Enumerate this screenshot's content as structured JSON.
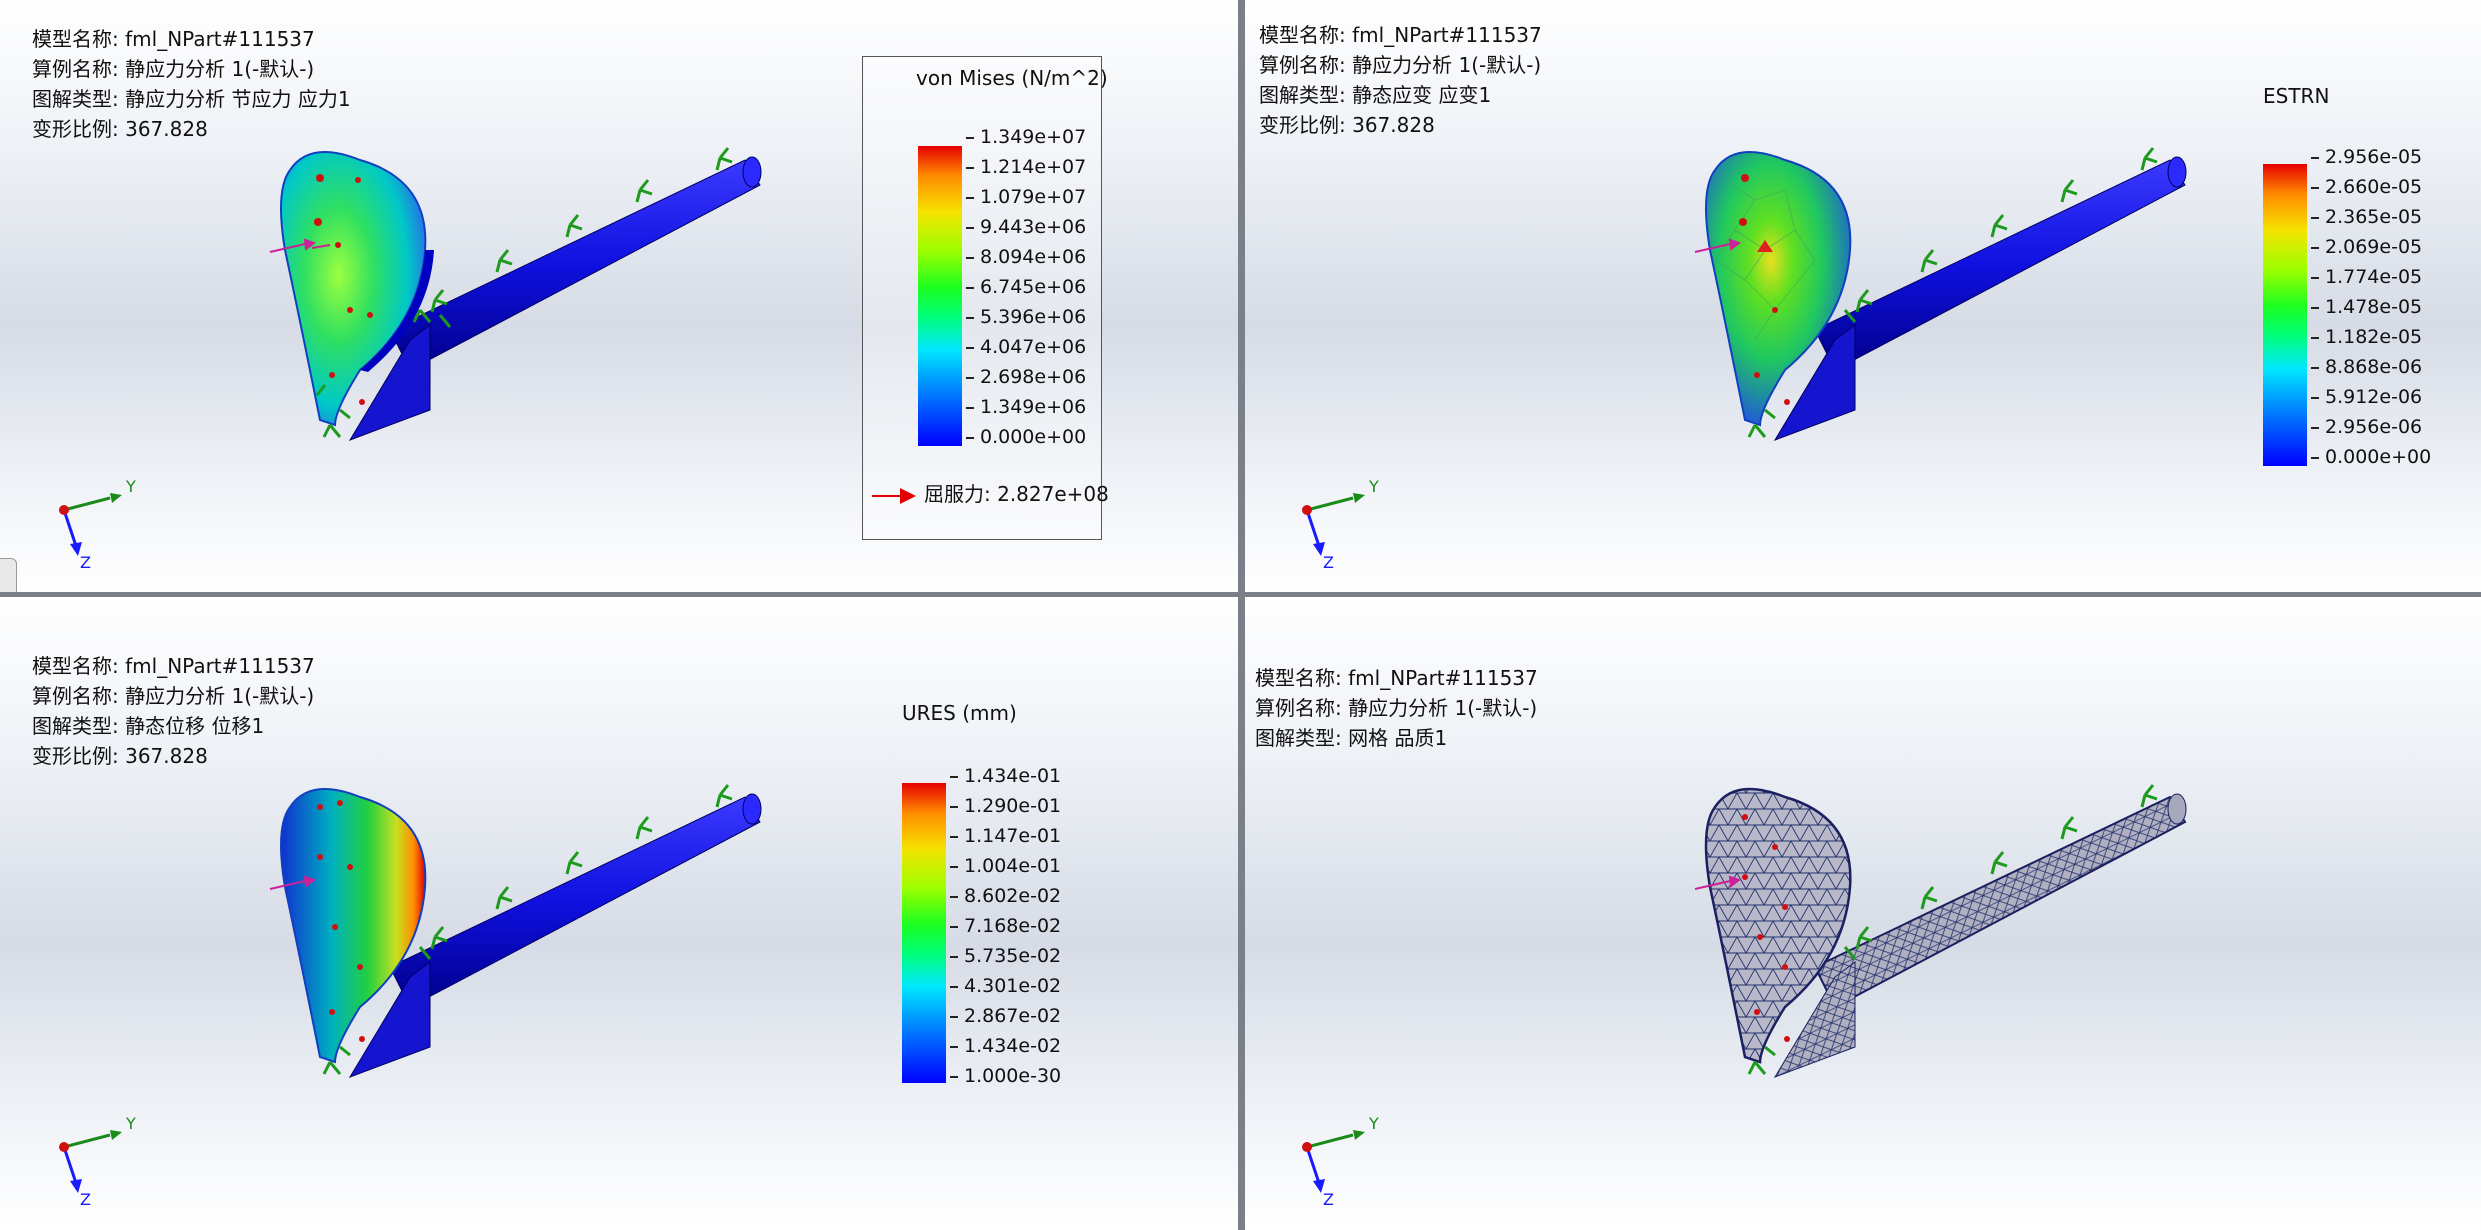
{
  "views": [
    {
      "id": "stress",
      "info": [
        {
          "k": "模型名称:",
          "v": "fml_NPart#111537"
        },
        {
          "k": "算例名称:",
          "v": "静应力分析 1(-默认-)"
        },
        {
          "k": "图解类型:",
          "v": "静应力分析 节应力 应力1"
        },
        {
          "k": "变形比例:",
          "v": "367.828"
        }
      ],
      "legend_title": "von Mises (N/m^2)",
      "ticks": [
        "1.349e+07",
        "1.214e+07",
        "1.079e+07",
        "9.443e+06",
        "8.094e+06",
        "6.745e+06",
        "5.396e+06",
        "4.047e+06",
        "2.698e+06",
        "1.349e+06",
        "0.000e+00"
      ],
      "yield_label": "屈服力: 2.827e+08"
    },
    {
      "id": "strain",
      "info": [
        {
          "k": "模型名称:",
          "v": "fml_NPart#111537"
        },
        {
          "k": "算例名称:",
          "v": "静应力分析 1(-默认-)"
        },
        {
          "k": "图解类型:",
          "v": "静态应变 应变1"
        },
        {
          "k": "变形比例:",
          "v": "367.828"
        }
      ],
      "legend_title": "ESTRN",
      "ticks": [
        "2.956e-05",
        "2.660e-05",
        "2.365e-05",
        "2.069e-05",
        "1.774e-05",
        "1.478e-05",
        "1.182e-05",
        "8.868e-06",
        "5.912e-06",
        "2.956e-06",
        "0.000e+00"
      ]
    },
    {
      "id": "displacement",
      "info": [
        {
          "k": "模型名称:",
          "v": "fml_NPart#111537"
        },
        {
          "k": "算例名称:",
          "v": "静应力分析 1(-默认-)"
        },
        {
          "k": "图解类型:",
          "v": "静态位移 位移1"
        },
        {
          "k": "变形比例:",
          "v": "367.828"
        }
      ],
      "legend_title": "URES (mm)",
      "ticks": [
        "1.434e-01",
        "1.290e-01",
        "1.147e-01",
        "1.004e-01",
        "8.602e-02",
        "7.168e-02",
        "5.735e-02",
        "4.301e-02",
        "2.867e-02",
        "1.434e-02",
        "1.000e-30"
      ]
    },
    {
      "id": "mesh",
      "info": [
        {
          "k": "模型名称:",
          "v": "fml_NPart#111537"
        },
        {
          "k": "算例名称:",
          "v": "静应力分析 1(-默认-)"
        },
        {
          "k": "图解类型:",
          "v": "网格 品质1"
        }
      ]
    }
  ],
  "triad": {
    "y_label": "Y",
    "z_label": "Z"
  },
  "colors": {
    "background_top": "#ffffff",
    "background_mid": "#d6dbe5",
    "rod": "#1a1aff",
    "fixture": "#22aa22",
    "load": "#cc2299",
    "mesh_face": "#b8b8c8",
    "mesh_line": "#20306a"
  },
  "icons": [
    "coordinate-triad-icon",
    "yield-arrow-icon",
    "fixture-anchor-icon",
    "load-arrow-icon"
  ]
}
